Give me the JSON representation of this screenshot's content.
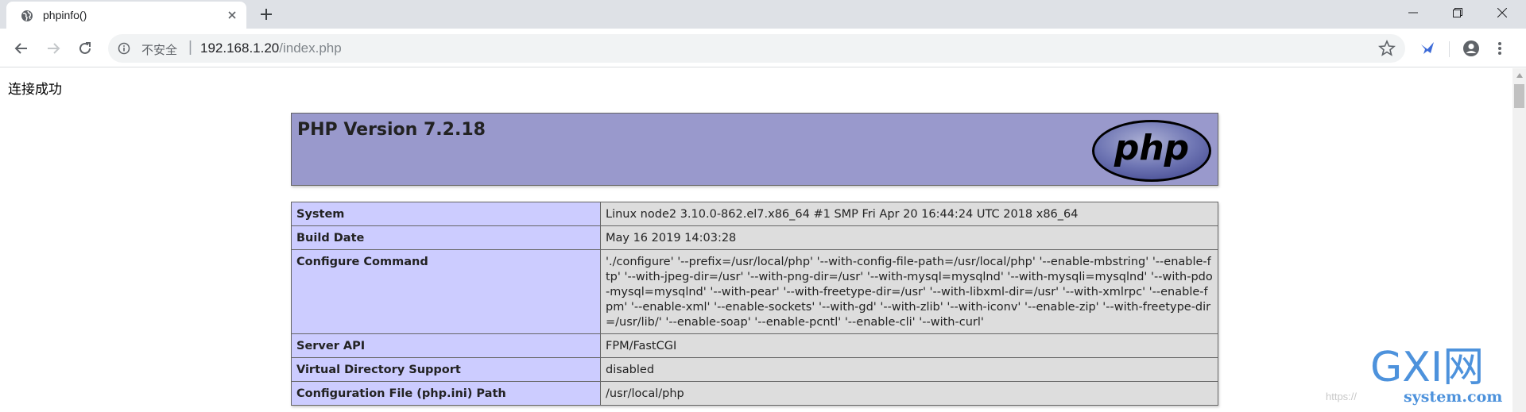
{
  "tab": {
    "title": "phpinfo()"
  },
  "address_bar": {
    "security_label": "不安全",
    "separator": "|",
    "url_host": "192.168.1.20",
    "url_path": "/index.php"
  },
  "page": {
    "status_text": "连接成功",
    "php_version": "PHP Version 7.2.18",
    "logo_text": "php",
    "info_rows": [
      {
        "label": "System",
        "value": "Linux node2 3.10.0-862.el7.x86_64 #1 SMP Fri Apr 20 16:44:24 UTC 2018 x86_64"
      },
      {
        "label": "Build Date",
        "value": "May 16 2019 14:03:28"
      },
      {
        "label": "Configure Command",
        "value": "'./configure' '--prefix=/usr/local/php' '--with-config-file-path=/usr/local/php' '--enable-mbstring' '--enable-ftp' '--with-jpeg-dir=/usr' '--with-png-dir=/usr' '--with-mysql=mysqlnd' '--with-mysqli=mysqlnd' '--with-pdo-mysql=mysqlnd' '--with-pear' '--with-freetype-dir=/usr' '--with-libxml-dir=/usr' '--with-xmlrpc' '--enable-fpm' '--enable-xml' '--enable-sockets' '--with-gd' '--with-zlib' '--with-iconv' '--enable-zip' '--with-freetype-dir=/usr/lib/' '--enable-soap' '--enable-pcntl' '--enable-cli' '--with-curl'"
      },
      {
        "label": "Server API",
        "value": "FPM/FastCGI"
      },
      {
        "label": "Virtual Directory Support",
        "value": "disabled"
      },
      {
        "label": "Configuration File (php.ini) Path",
        "value": "/usr/local/php"
      }
    ]
  },
  "watermark": {
    "brand": "GXI网",
    "domain": "system.com",
    "url_fragment": "https://"
  },
  "colors": {
    "php_header": "#9999cc",
    "label_cell": "#ccccff",
    "value_cell": "#dddddd",
    "tabstrip": "#dee1e6"
  }
}
